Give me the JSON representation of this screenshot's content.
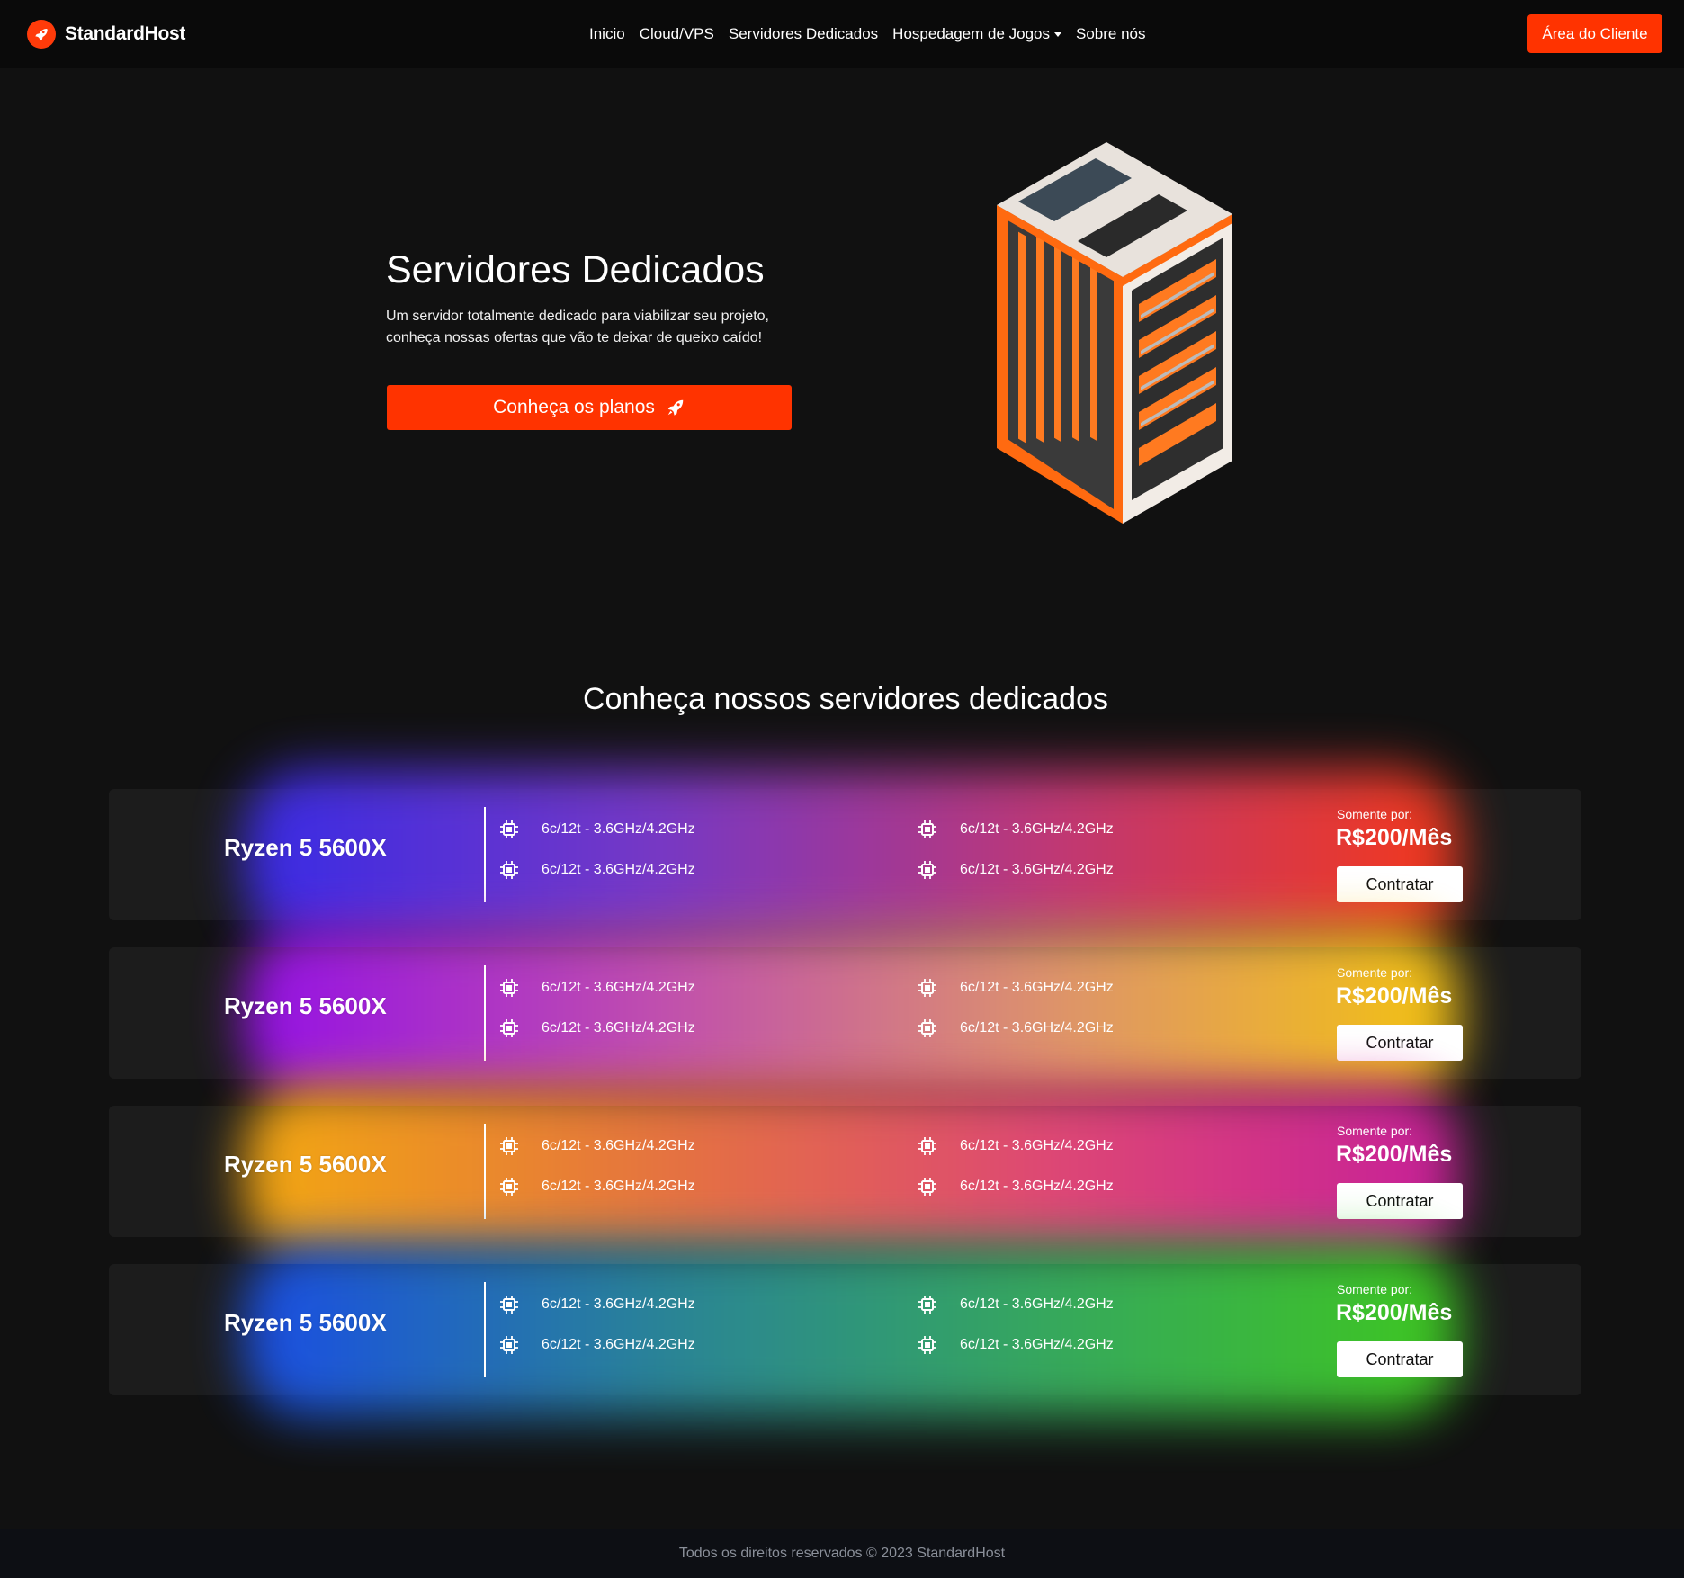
{
  "nav": {
    "brand": "StandardHost",
    "links": [
      {
        "label": "Inicio"
      },
      {
        "label": "Cloud/VPS"
      },
      {
        "label": "Servidores Dedicados"
      },
      {
        "label": "Hospedagem de Jogos",
        "dropdown": true
      },
      {
        "label": "Sobre nós"
      }
    ],
    "client_button": "Área do Cliente"
  },
  "hero": {
    "title": "Servidores Dedicados",
    "description": "Um servidor totalmente dedicado para viabilizar seu projeto, conheça nossas ofertas que vão te deixar de queixo caído!",
    "cta": "Conheça os planos"
  },
  "section": {
    "title": "Conheça nossos servidores dedicados"
  },
  "plans": [
    {
      "name": "Ryzen 5 5600X",
      "specs": [
        "6c/12t - 3.6GHz/4.2GHz",
        "6c/12t - 3.6GHz/4.2GHz",
        "6c/12t - 3.6GHz/4.2GHz",
        "6c/12t - 3.6GHz/4.2GHz"
      ],
      "price_label": "Somente por:",
      "price": "R$200/Mês",
      "button": "Contratar",
      "gradient": [
        "#3a2cf0",
        "#7a3ad0",
        "#c83a7a",
        "#ff3a1a"
      ]
    },
    {
      "name": "Ryzen 5 5600X",
      "specs": [
        "6c/12t - 3.6GHz/4.2GHz",
        "6c/12t - 3.6GHz/4.2GHz",
        "6c/12t - 3.6GHz/4.2GHz",
        "6c/12t - 3.6GHz/4.2GHz"
      ],
      "price_label": "Somente por:",
      "price": "R$200/Mês",
      "button": "Contratar",
      "gradient": [
        "#9a10f0",
        "#c850b8",
        "#e89a70",
        "#ffcc10"
      ]
    },
    {
      "name": "Ryzen 5 5600X",
      "specs": [
        "6c/12t - 3.6GHz/4.2GHz",
        "6c/12t - 3.6GHz/4.2GHz",
        "6c/12t - 3.6GHz/4.2GHz",
        "6c/12t - 3.6GHz/4.2GHz"
      ],
      "price_label": "Somente por:",
      "price": "R$200/Mês",
      "button": "Contratar",
      "gradient": [
        "#ffb010",
        "#f07a40",
        "#e84a7a",
        "#d020a0"
      ]
    },
    {
      "name": "Ryzen 5 5600X",
      "specs": [
        "6c/12t - 3.6GHz/4.2GHz",
        "6c/12t - 3.6GHz/4.2GHz",
        "6c/12t - 3.6GHz/4.2GHz",
        "6c/12t - 3.6GHz/4.2GHz"
      ],
      "price_label": "Somente por:",
      "price": "R$200/Mês",
      "button": "Contratar",
      "gradient": [
        "#1a50f0",
        "#2a88a0",
        "#38b060",
        "#40d020"
      ]
    }
  ],
  "footer": {
    "text": "Todos os direitos reservados © 2023 StandardHost"
  }
}
